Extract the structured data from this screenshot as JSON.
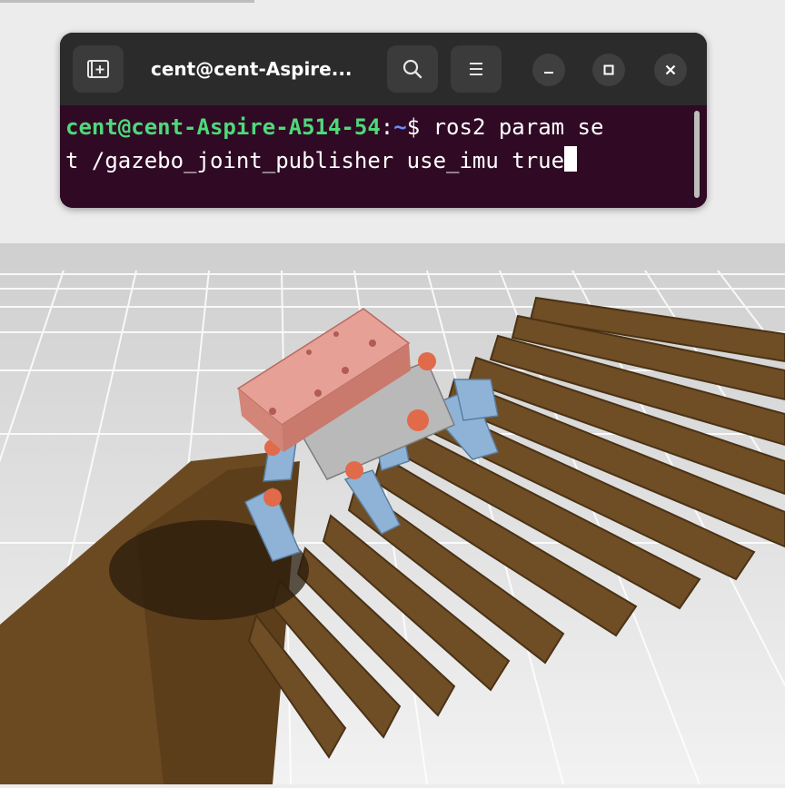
{
  "terminal": {
    "title": "cent@cent-Aspire...",
    "prompt_user_host": "cent@cent-Aspire-A514-54",
    "prompt_separator": ":",
    "prompt_path": "~",
    "prompt_symbol": "$ ",
    "command_line1": "ros2 param se",
    "command_line2": "t /gazebo_joint_publisher use_imu true",
    "buttons": {
      "new_tab": "new-tab-icon",
      "search": "search-icon",
      "menu": "hamburger-menu-icon",
      "minimize": "minimize-icon",
      "maximize": "maximize-icon",
      "close": "close-icon"
    },
    "colors": {
      "background": "#300a24",
      "titlebar": "#2b2b2b",
      "prompt_user": "#4ed97a",
      "prompt_path": "#6a8cff"
    }
  },
  "simulation": {
    "description_objects": [
      "ground-grid",
      "wooden-stairs",
      "hexapod-robot"
    ],
    "colors": {
      "ground": "#dcdcdc",
      "stairs": "#6b4a22",
      "robot_body": "#e0958a",
      "robot_legs": "#8fb3d6",
      "robot_joints": "#e06a4a"
    }
  }
}
